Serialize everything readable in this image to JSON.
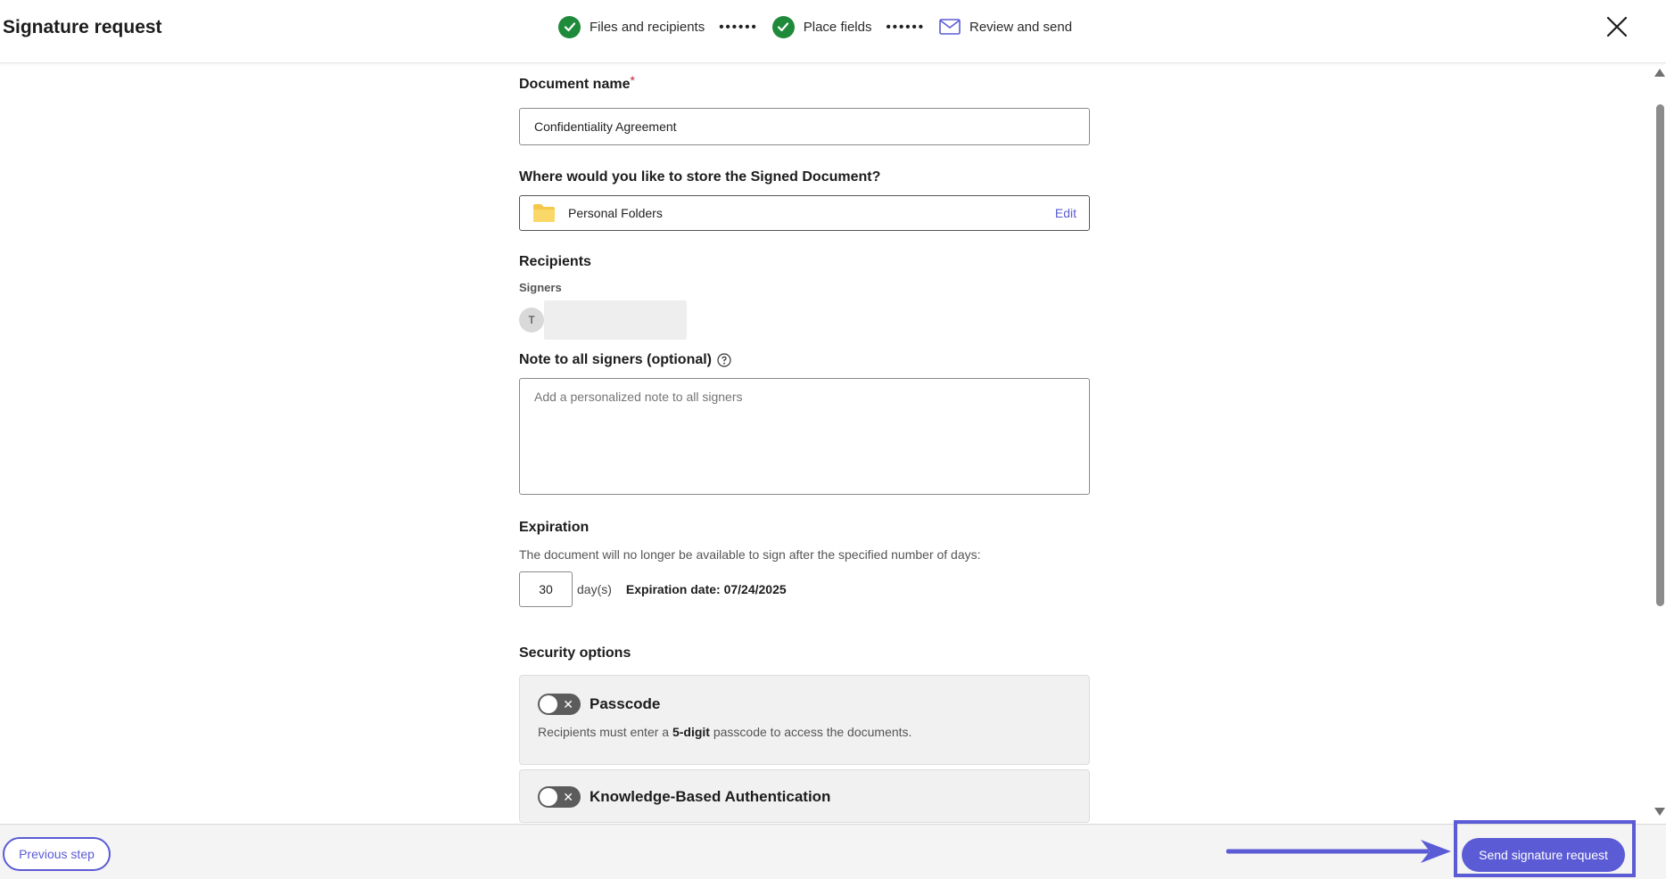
{
  "header": {
    "title": "Signature request",
    "steps": [
      {
        "label": "Files and recipients",
        "status": "complete"
      },
      {
        "label": "Place fields",
        "status": "complete"
      },
      {
        "label": "Review and send",
        "status": "current"
      }
    ],
    "step_separator": "••••••",
    "close_icon": "close-icon"
  },
  "form": {
    "document_name_label": "Document name",
    "document_name_required_mark": "*",
    "document_name_value": "Confidentiality Agreement",
    "storage_label": "Where would you like to store the Signed Document?",
    "storage_value": "Personal Folders",
    "storage_edit": "Edit",
    "recipients_label": "Recipients",
    "signers_label": "Signers",
    "signer_initial": "T",
    "note_label": "Note to all signers (optional)",
    "note_placeholder": "Add a personalized note to all signers",
    "expiration_label": "Expiration",
    "expiration_desc": "The document will no longer be available to sign after the specified number of days:",
    "expiration_days": "30",
    "expiration_unit": "day(s)",
    "expiration_date": "Expiration date: 07/24/2025",
    "security_label": "Security options",
    "security_options": [
      {
        "title": "Passcode",
        "enabled": false,
        "desc_pre": "Recipients must enter a ",
        "desc_bold": "5-digit",
        "desc_post": " passcode to access the documents."
      },
      {
        "title": "Knowledge-Based Authentication",
        "enabled": false
      }
    ]
  },
  "footer": {
    "previous_label": "Previous step",
    "send_label": "Send signature request"
  },
  "colors": {
    "accent": "#5b5bd6",
    "success": "#1f8a3a",
    "required": "#c4262e"
  }
}
